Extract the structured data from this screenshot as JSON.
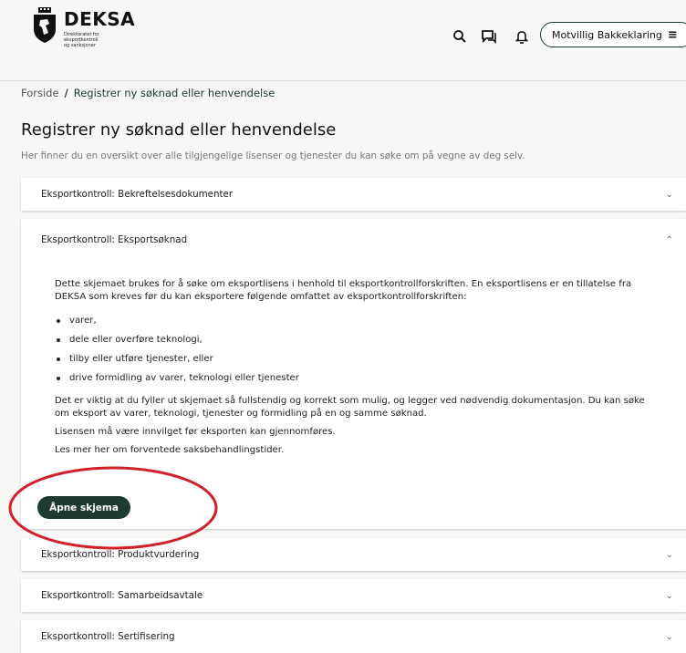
{
  "header": {
    "logo_name": "DEKSA",
    "logo_sub": [
      "Direktoratet for",
      "eksportkontroll",
      "og sanksjoner"
    ],
    "user_label": "Motvillig Bakkeklaring",
    "menu_glyph": "≡",
    "icons": [
      "search-icon",
      "chat-icon",
      "bell-icon",
      "menu-icon"
    ]
  },
  "breadcrumb": {
    "home": "Forside",
    "sep": "/",
    "current": "Registrer ny søknad eller henvendelse"
  },
  "page": {
    "title": "Registrer ny søknad eller henvendelse",
    "intro": "Her finner du en oversikt over alle tilgjengelige lisenser og tjenester du kan søke om på vegne av deg selv."
  },
  "accordion": {
    "items": [
      {
        "label": "Eksportkontroll: Bekreftelsesdokumenter"
      },
      {
        "label": "Eksportkontroll: Eksportsøknad"
      },
      {
        "label": "Eksportkontroll: Produktvurdering"
      },
      {
        "label": "Eksportkontroll: Samarbeidsavtale"
      },
      {
        "label": "Eksportkontroll: Sertifisering"
      }
    ],
    "chevron_down": "⌄",
    "chevron_up": "⌃",
    "expanded": {
      "para1": "Dette skjemaet brukes for å søke om eksportlisens i henhold til eksportkontrollforskriften. En eksportlisens er en tillatelse fra DEKSA som kreves før du kan eksportere følgende omfattet av eksportkontrollforskriften:",
      "bullets": [
        "varer,",
        "dele eller overføre teknologi,",
        "tilby eller utføre tjenester, eller",
        "drive formidling av varer, teknologi eller tjenester"
      ],
      "para2": "Det er viktig at du fyller ut skjemaet så fullstendig og korrekt som mulig, og legger ved nødvendig dokumentasjon. Du kan søke om eksport av varer, teknologi, tjenester og formidling på en og samme søknad.",
      "para3": "Lisensen må være innvilget før eksporten kan gjennomføres.",
      "para4": "Les mer her om forventede saksbehandlingstider.",
      "open_button": "Åpne skjema"
    }
  },
  "colors": {
    "brand": "#1d3a30",
    "annotation": "#d0202a"
  }
}
